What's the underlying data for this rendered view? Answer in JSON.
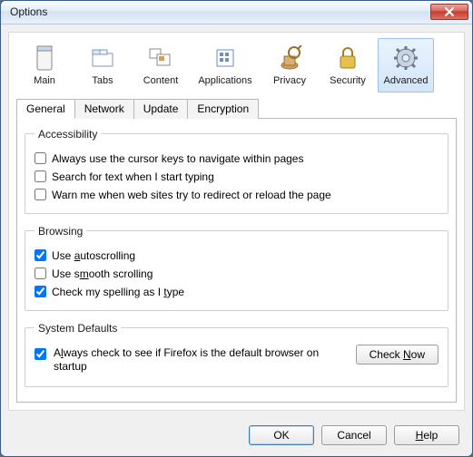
{
  "window": {
    "title": "Options"
  },
  "toolbar": {
    "items": [
      {
        "label": "Main"
      },
      {
        "label": "Tabs"
      },
      {
        "label": "Content"
      },
      {
        "label": "Applications"
      },
      {
        "label": "Privacy"
      },
      {
        "label": "Security"
      },
      {
        "label": "Advanced"
      }
    ]
  },
  "tabs": {
    "items": [
      {
        "label": "General"
      },
      {
        "label": "Network"
      },
      {
        "label": "Update"
      },
      {
        "label": "Encryption"
      }
    ]
  },
  "groups": {
    "accessibility": {
      "legend": "Accessibility",
      "opt0": "Always use the cursor keys to navigate within pages",
      "opt1": "Search for text when I start typing",
      "opt2": "Warn me when web sites try to redirect or reload the page"
    },
    "browsing": {
      "legend": "Browsing",
      "autoscroll_pre": "Use ",
      "autoscroll_u": "a",
      "autoscroll_post": "utoscrolling",
      "smooth_pre": "Use s",
      "smooth_u": "m",
      "smooth_post": "ooth scrolling",
      "spell_pre": "Check my spelling as I ",
      "spell_u": "t",
      "spell_post": "ype"
    },
    "system": {
      "legend": "System Defaults",
      "opt0_pre": "A",
      "opt0_u": "l",
      "opt0_post": "ways check to see if Firefox is the default browser on startup",
      "check_now_pre": "Check ",
      "check_now_u": "N",
      "check_now_post": "ow"
    }
  },
  "buttons": {
    "ok": "OK",
    "cancel": "Cancel",
    "help_u": "H",
    "help_post": "elp"
  }
}
